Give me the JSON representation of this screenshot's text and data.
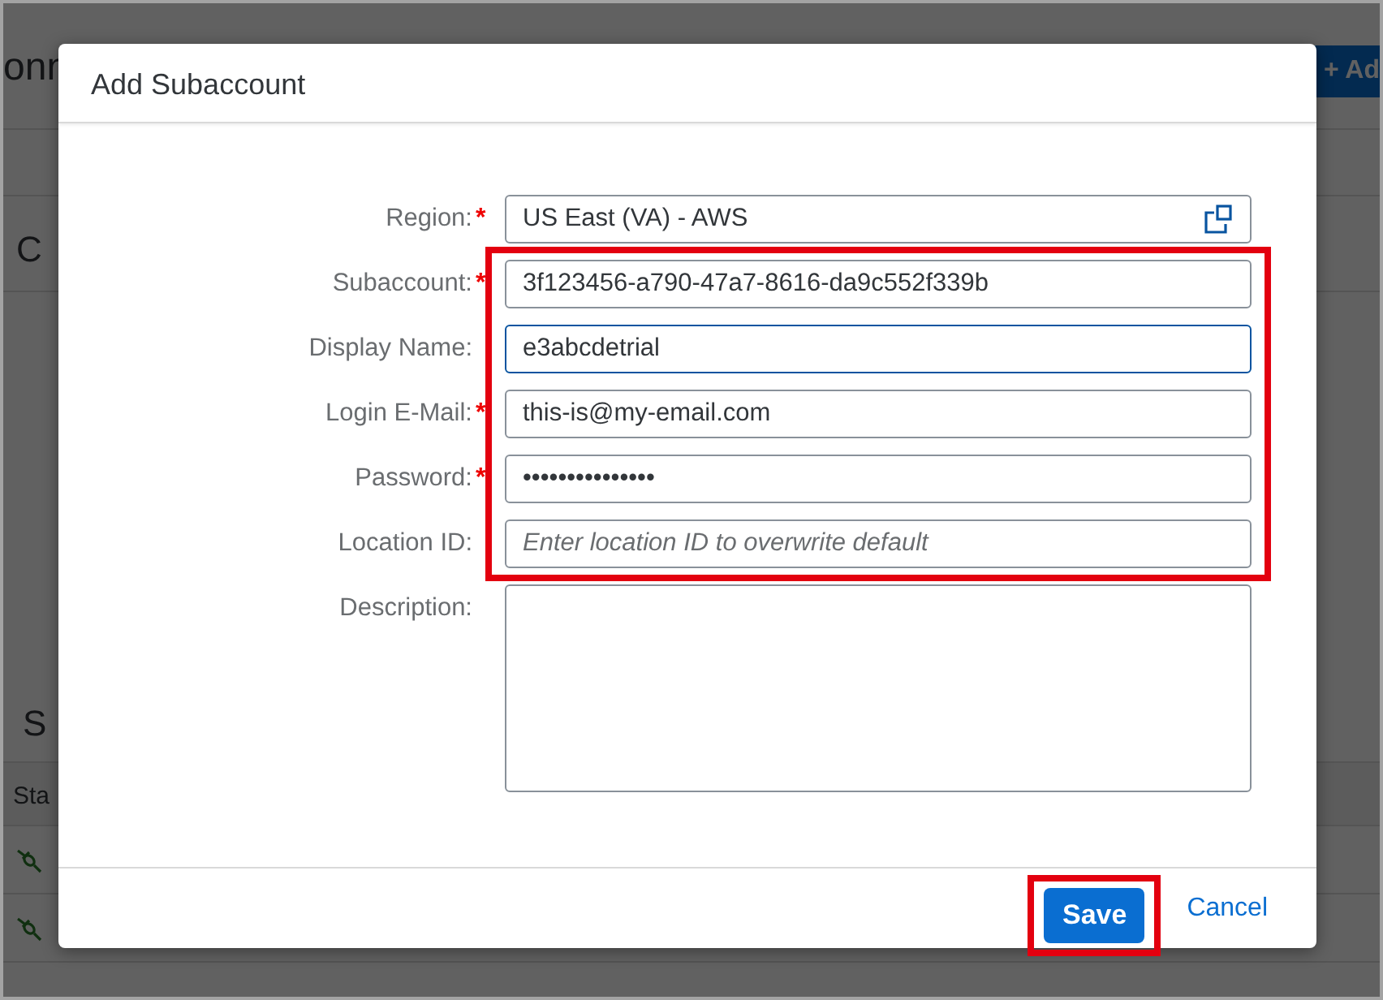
{
  "background": {
    "page_title": "onn",
    "add_button": "+ Ad",
    "section_title": "C",
    "table_title": "S",
    "table": {
      "columns": [
        "Sta"
      ],
      "rows": [
        {
          "kind": "unplugged"
        },
        {
          "kind": "unplugged"
        }
      ]
    }
  },
  "dialog": {
    "title": "Add Subaccount",
    "required_mark": "*",
    "fields": [
      {
        "label": "Region:",
        "required": true,
        "kind": "select",
        "value": "US East (VA) - AWS",
        "focused": false,
        "highlighted": false
      },
      {
        "label": "Subaccount:",
        "required": true,
        "kind": "text",
        "value": "3f123456-a790-47a7-8616-da9c552f339b",
        "focused": false,
        "highlighted": true
      },
      {
        "label": "Display Name:",
        "required": false,
        "kind": "text",
        "value": "e3abcdetrial",
        "focused": true,
        "highlighted": true
      },
      {
        "label": "Login E-Mail:",
        "required": true,
        "kind": "text",
        "value": "this-is@my-email.com",
        "focused": false,
        "highlighted": true
      },
      {
        "label": "Password:",
        "required": true,
        "kind": "password",
        "value": "•••••••••••••••",
        "focused": false,
        "highlighted": true
      },
      {
        "label": "Location ID:",
        "required": false,
        "kind": "text",
        "placeholder": "Enter location ID to overwrite default",
        "focused": false,
        "highlighted": true
      },
      {
        "label": "Description:",
        "required": false,
        "kind": "textarea",
        "focused": false,
        "highlighted": false
      }
    ],
    "buttons": [
      {
        "label": "Save",
        "kind": "emphasized",
        "highlighted": true
      },
      {
        "label": "Cancel",
        "kind": "transparent",
        "highlighted": false
      }
    ]
  }
}
